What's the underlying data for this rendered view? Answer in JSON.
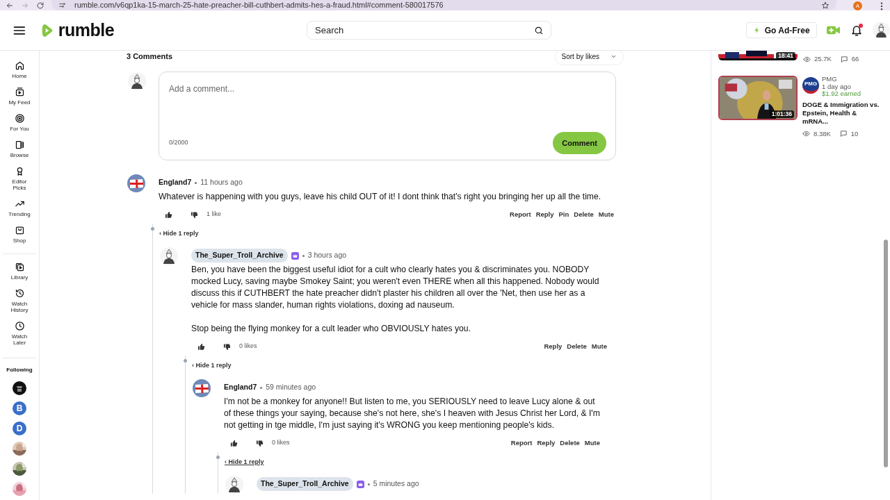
{
  "browser": {
    "url": "rumble.com/v6qp1ka-15-march-25-hate-preacher-bill-cuthbert-admits-hes-a-fraud.html#comment-580017576",
    "profile_initial": "A"
  },
  "header": {
    "brand": "rumble",
    "search_placeholder": "Search",
    "ad_free_button": "Go Ad-Free",
    "notification_unread": true
  },
  "sidebar": {
    "items": [
      {
        "label": "Home"
      },
      {
        "label": "My Feed"
      },
      {
        "label": "For You"
      },
      {
        "label": "Browse"
      },
      {
        "label": "Editor Picks"
      },
      {
        "label": "Trending"
      },
      {
        "label": "Shop"
      },
      {
        "label": "Library"
      },
      {
        "label": "Watch History"
      },
      {
        "label": "Watch Later"
      }
    ],
    "section_title": "Following",
    "following": [
      {
        "kind": "logo"
      },
      {
        "kind": "letter",
        "letter": "B"
      },
      {
        "kind": "letter",
        "letter": "D"
      },
      {
        "kind": "picture"
      },
      {
        "kind": "picture"
      },
      {
        "kind": "picture"
      }
    ]
  },
  "comments": {
    "count_label": "3 Comments",
    "sort": "Sort by likes",
    "composer": {
      "placeholder": "Add a comment...",
      "counter": "0/2000",
      "submit": "Comment"
    },
    "thread": [
      {
        "kind": "flag",
        "author": "England7",
        "highlighted": false,
        "crown": false,
        "time": "11 hours ago",
        "paragraphs": [
          "Whatever is happening with you guys, leave his child OUT of it! I dont think that's right you bringing her up all the time."
        ],
        "likes": "1 like",
        "actions": [
          "Report",
          "Reply",
          "Pin",
          "Delete",
          "Mute"
        ],
        "toggle": "‹ Hide 1 reply",
        "toggle_underlined": false,
        "children": [
          {
            "kind": "figure",
            "author": "The_Super_Troll_Archive",
            "highlighted": true,
            "crown": true,
            "time": "3 hours ago",
            "paragraphs": [
              "Ben, you have been the biggest useful idiot for a cult who clearly hates you & discriminates you. NOBODY mocked Lucy, saving maybe Smokey Saint; you weren't even THERE when all this happened. Nobody would discuss this if CUTHBERT the hate preacher didn't plaster his children all over the 'Net, then use her as a vehicle for mass slander, human rights violations, doxing ad nauseum.",
              "Stop being the flying monkey for a cult leader who OBVIOUSLY hates you."
            ],
            "likes": "0 likes",
            "actions": [
              "Reply",
              "Delete",
              "Mute"
            ],
            "toggle": "‹ Hide 1 reply",
            "toggle_underlined": false,
            "children": [
              {
                "kind": "flag",
                "author": "England7",
                "highlighted": false,
                "crown": false,
                "time": "59 minutes ago",
                "paragraphs": [
                  "I'm not be a monkey for anyone!! But listen to me, you SERIOUSLY need to leave Lucy alone & out of these things your saying, because she's not here, she's I heaven with Jesus Christ her Lord, & I'm not getting in tge middle, I'm just saying it's WRONG you keep mentioning people's kids."
                ],
                "likes": "0 likes",
                "actions": [
                  "Report",
                  "Reply",
                  "Delete",
                  "Mute"
                ],
                "toggle": "‹ Hide 1 reply",
                "toggle_underlined": true,
                "children": [
                  {
                    "kind": "figure",
                    "author": "The_Super_Troll_Archive",
                    "highlighted": true,
                    "crown": true,
                    "time": "5 minutes ago"
                  }
                ]
              }
            ]
          }
        ]
      }
    ]
  },
  "recommendations": [
    {
      "kind": "cut",
      "duration": "18:41",
      "views": "25.7K",
      "comments": "66"
    },
    {
      "kind": "full",
      "duration": "1:01:36",
      "channel": "PMG",
      "avatar_label": "PMG",
      "age": "1 day ago",
      "earnings": "$1.92 earned",
      "title": "DOGE & Immigration vs. Epstein, Health & mRNA...",
      "views": "8.38K",
      "comments": "10"
    }
  ]
}
